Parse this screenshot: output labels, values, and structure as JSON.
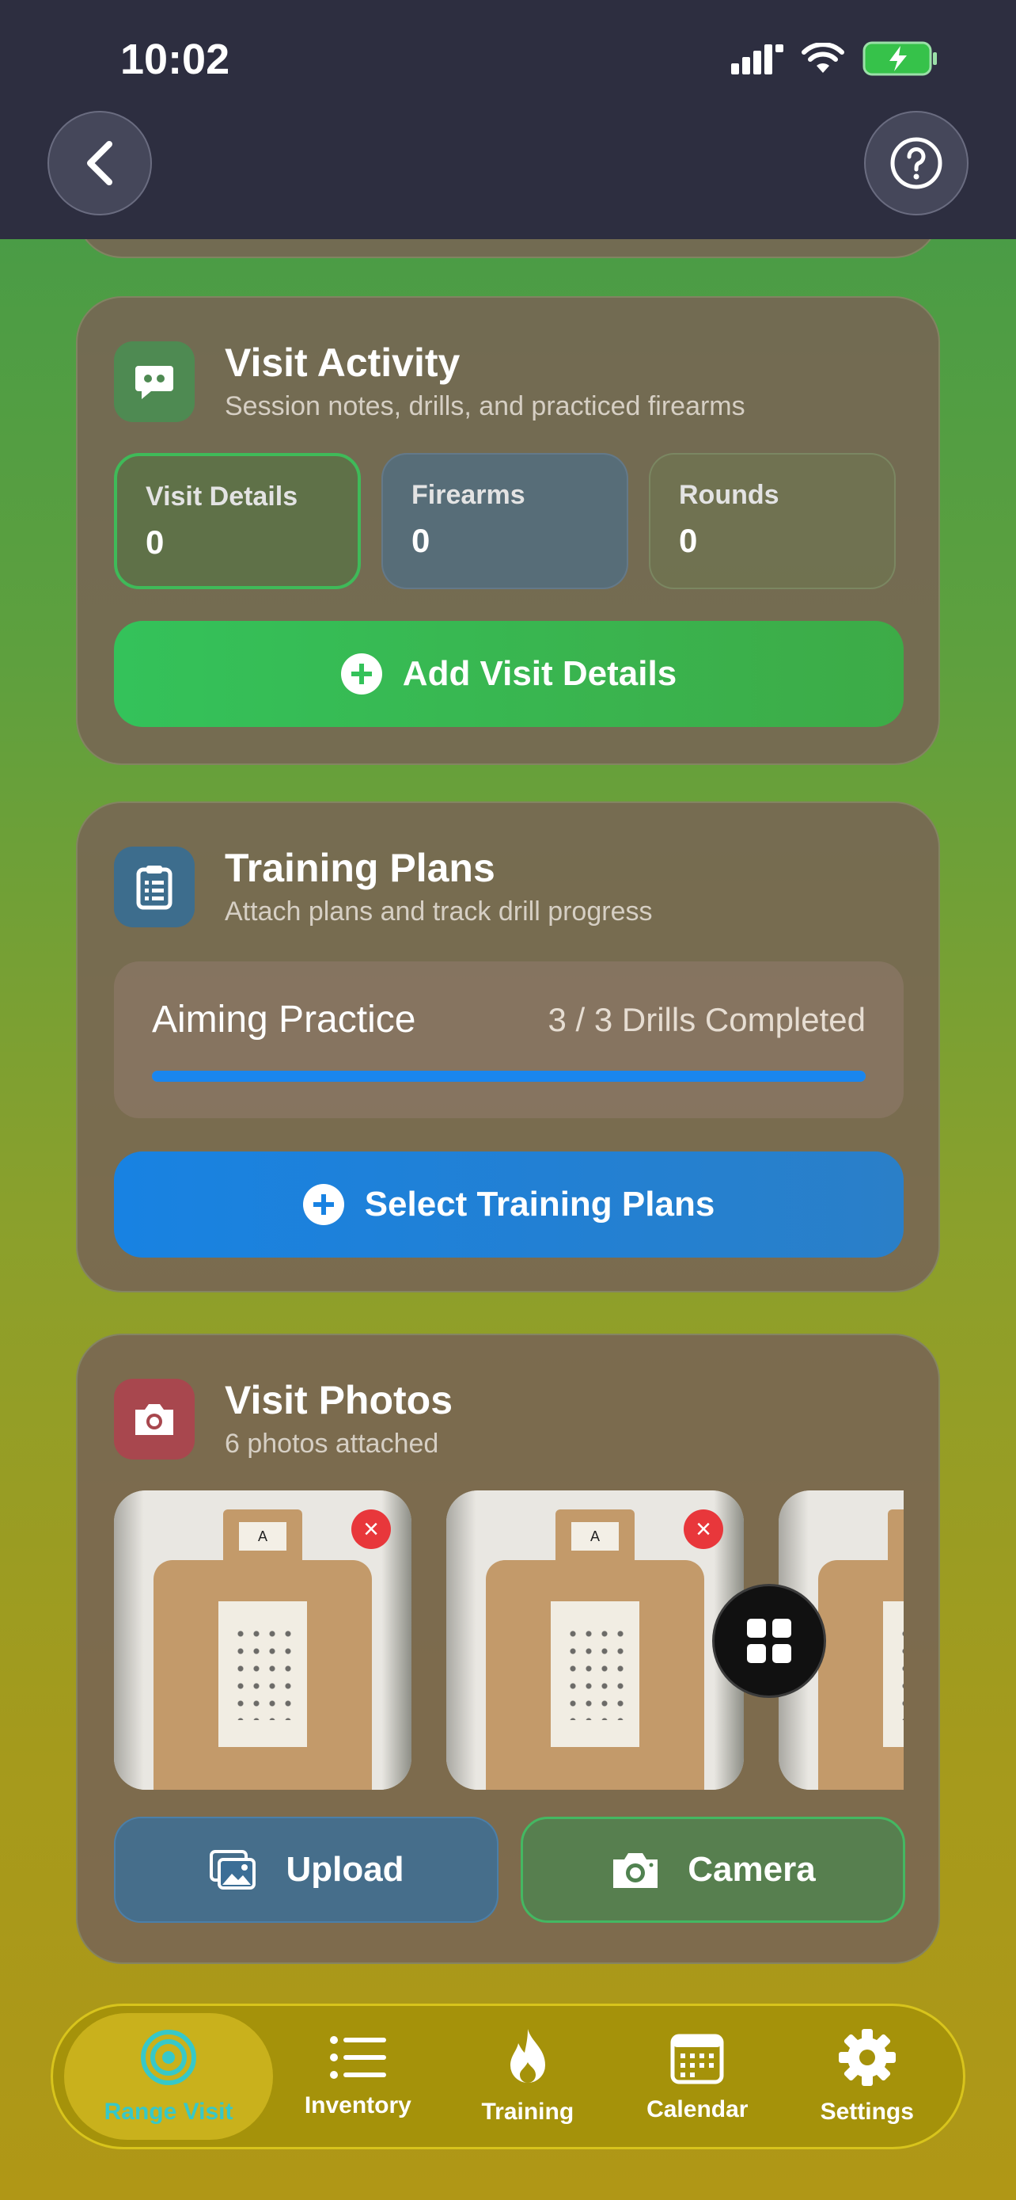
{
  "status_bar": {
    "time": "10:02"
  },
  "visit_activity": {
    "title": "Visit Activity",
    "subtitle": "Session notes, drills, and practiced firearms",
    "stats": [
      {
        "label": "Visit Details",
        "value": "0"
      },
      {
        "label": "Firearms",
        "value": "0"
      },
      {
        "label": "Rounds",
        "value": "0"
      }
    ],
    "add_button": "Add Visit Details"
  },
  "training_plans": {
    "title": "Training Plans",
    "subtitle": "Attach plans and track drill progress",
    "plan": {
      "name": "Aiming Practice",
      "progress_text": "3 / 3 Drills Completed",
      "progress": 1.0
    },
    "select_button": "Select Training Plans"
  },
  "visit_photos": {
    "title": "Visit Photos",
    "subtitle": "6 photos attached",
    "upload_button": "Upload",
    "camera_button": "Camera"
  },
  "tabs": [
    {
      "label": "Range Visit",
      "icon": "target-icon",
      "active": true
    },
    {
      "label": "Inventory",
      "icon": "list-icon",
      "active": false
    },
    {
      "label": "Training",
      "icon": "flame-icon",
      "active": false
    },
    {
      "label": "Calendar",
      "icon": "calendar-icon",
      "active": false
    },
    {
      "label": "Settings",
      "icon": "gear-icon",
      "active": false
    }
  ],
  "colors": {
    "accent_green": "#34c25a",
    "accent_blue": "#1882e2",
    "active_tab": "#37c8c8",
    "remove_red": "#e8373b"
  }
}
